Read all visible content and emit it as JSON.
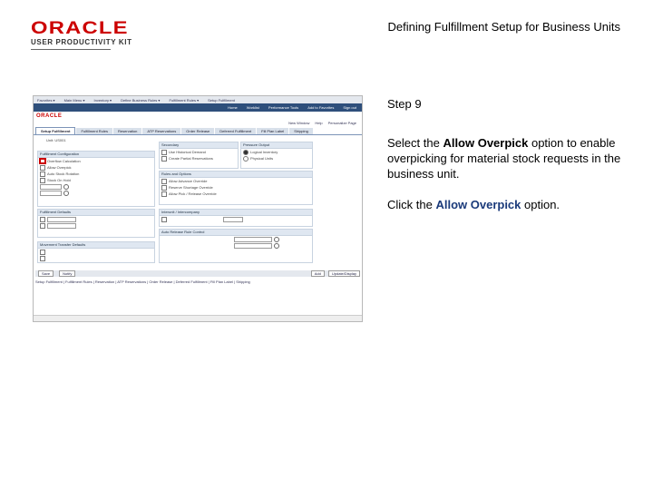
{
  "header": {
    "logo_main": "ORACLE",
    "logo_sub": "USER PRODUCTIVITY KIT",
    "doc_title": "Defining Fulfillment Setup for Business Units"
  },
  "screenshot": {
    "tabs": [
      "Setup Fulfillment",
      "Fulfillment Rules",
      "Reservation",
      "ATP Reservations",
      "Order Release",
      "Deferred Fulfillment",
      "Fill Plan Label",
      "Shipping"
    ],
    "unit_label": "Unit:",
    "unit_value": "US001",
    "group_fulfillment": "Fulfillment Configuration",
    "group_secondary": "Secondary",
    "group_pressure": "Pressure Output",
    "group_interunit": "Interunit / Intercompany",
    "group_options": "Rules and Options",
    "group_auto": "Auto Release Rule Control",
    "group_fulfill_defaults": "Fulfillment Defaults",
    "group_putaway": "Movement Transfer Defaults",
    "allow_overpick": "Allow Overpick",
    "left_rows": [
      "Overflow Calculation",
      "Allow Overpick",
      "Auto Stock Rotation",
      "Stock On Hold"
    ],
    "right_rows_a": [
      "Use Historical Demand",
      "Create Partial Reservations"
    ],
    "radio_a": [
      "Logical Inventory",
      "Physical Units"
    ],
    "right_rows_b": [
      "Allow Advance Override",
      "Reserve Shortage Override",
      "Allow Pick / Release Override"
    ],
    "buttons": [
      "Save",
      "Notify",
      "Update/Display",
      "Add",
      "Include History"
    ],
    "footer_links": "Setup Fulfillment | Fulfillment Rules | Reservation | ATP Reservations | Order Release | Deferred Fulfillment | Fill Plan Label | Shipping"
  },
  "instructions": {
    "step": "Step 9",
    "p1_before": "Select the ",
    "p1_bold": "Allow Overpick",
    "p1_after": " option to enable overpicking for material stock requests in the business unit.",
    "p2_before": "Click the ",
    "p2_bold": "Allow Overpick",
    "p2_after": " option."
  },
  "colors": {
    "logo_red": "#cc0000",
    "highlight": "#cc0000",
    "nav_blue": "#2e4f7b",
    "link_blue": "#1a3a7a"
  }
}
